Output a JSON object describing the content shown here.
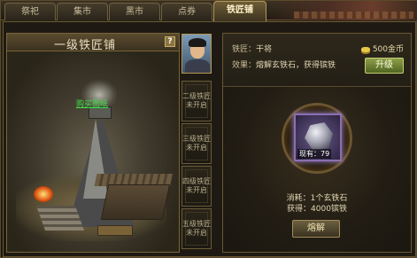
{
  "tabs": [
    {
      "label": "祭祀",
      "active": false
    },
    {
      "label": "集市",
      "active": false
    },
    {
      "label": "黑市",
      "active": false
    },
    {
      "label": "点券",
      "active": false
    },
    {
      "label": "铁匠铺",
      "active": true
    }
  ],
  "left_panel": {
    "title": "一级铁匠铺",
    "help": "?",
    "buy_link": "购买图纸"
  },
  "slots": [
    {
      "label": "二级铁匠未开启"
    },
    {
      "label": "三级铁匠未开启"
    },
    {
      "label": "四级铁匠未开启"
    },
    {
      "label": "五级铁匠未开启"
    }
  ],
  "info": {
    "smith_label": "铁匠：",
    "smith_value": "干将",
    "effect_label": "效果：",
    "effect_value": "熔解玄铁石，获得镔铁",
    "money": "500金币",
    "upgrade_button": "升级"
  },
  "fuse": {
    "item_count": "现有：79",
    "cost_line": "消耗：1个玄铁石",
    "gain_line": "获得：4000镔铁",
    "fuse_button": "熔解"
  }
}
